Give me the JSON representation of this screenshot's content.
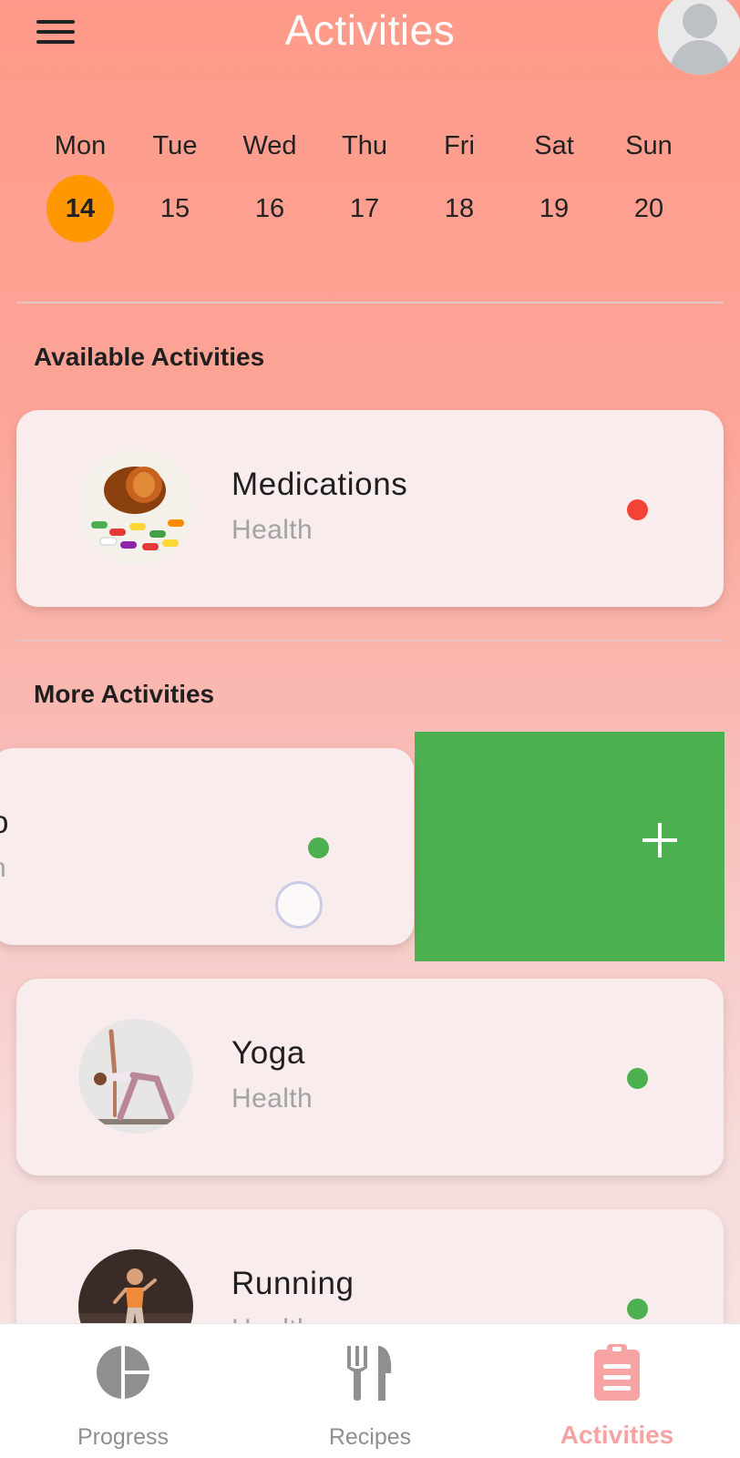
{
  "app": {
    "title": "Activities",
    "accent_color": "#ff9800",
    "swipe_action_color": "#4caf50"
  },
  "header": {
    "menu_icon": "hamburger-menu-icon",
    "avatar_icon": "user-avatar-icon"
  },
  "week": {
    "days": [
      {
        "name": "Mon",
        "num": "14",
        "selected": true
      },
      {
        "name": "Tue",
        "num": "15"
      },
      {
        "name": "Wed",
        "num": "16"
      },
      {
        "name": "Thu",
        "num": "17"
      },
      {
        "name": "Fri",
        "num": "18"
      },
      {
        "name": "Sat",
        "num": "19"
      },
      {
        "name": "Sun",
        "num": "20"
      }
    ]
  },
  "available": {
    "title": "Available Activities",
    "items": [
      {
        "name": "Medications",
        "category": "Health",
        "status_color": "#f44336"
      }
    ]
  },
  "more": {
    "title": "More Activities",
    "swiped_item": {
      "name_partial": "o",
      "category_partial": "h",
      "status_color": "#4caf50"
    },
    "swipe_action_icon": "plus-icon",
    "items": [
      {
        "name": "Yoga",
        "category": "Health",
        "status_color": "#4caf50"
      },
      {
        "name": "Running",
        "category": "Health",
        "status_color": "#4caf50"
      }
    ]
  },
  "bottom_nav": {
    "items": [
      {
        "label": "Progress",
        "icon": "pie-chart-icon"
      },
      {
        "label": "Recipes",
        "icon": "fork-knife-icon"
      },
      {
        "label": "Activities",
        "icon": "clipboard-icon",
        "active": true
      }
    ]
  }
}
